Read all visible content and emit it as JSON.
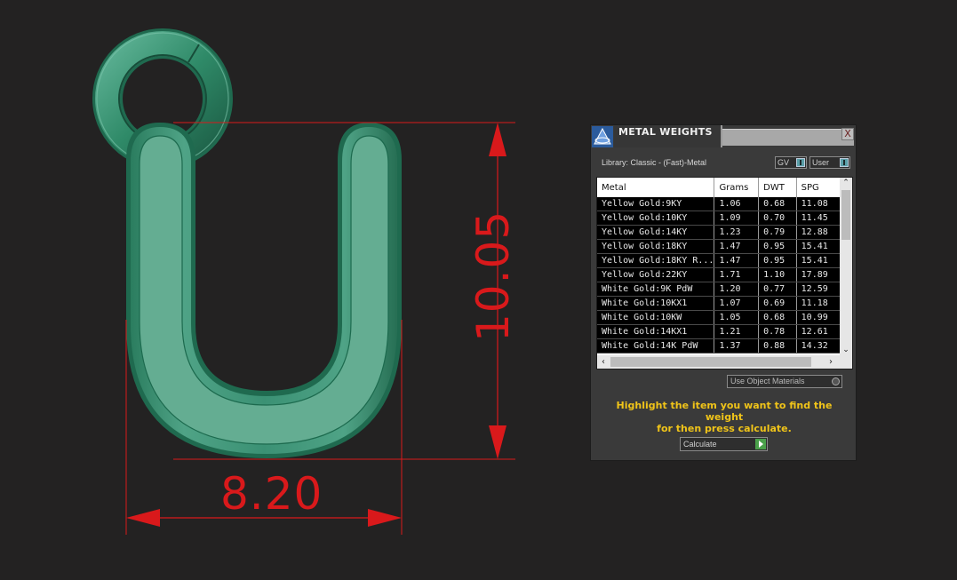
{
  "viewport": {
    "dimension_vertical": "10.05",
    "dimension_horizontal": "8.20",
    "colors": {
      "background": "#232222",
      "model": "#2f8a68",
      "dimension": "#d9191b"
    }
  },
  "panel": {
    "title": "METAL WEIGHTS",
    "close_label": "X",
    "library_label": "Library: Classic - (Fast)-Metal",
    "gv_toggle": "GV",
    "user_toggle": "User",
    "table": {
      "columns": [
        "Metal",
        "Grams",
        "DWT",
        "SPG"
      ],
      "rows": [
        [
          "Yellow Gold:9KY",
          "1.06",
          "0.68",
          "11.08"
        ],
        [
          "Yellow Gold:10KY",
          "1.09",
          "0.70",
          "11.45"
        ],
        [
          "Yellow Gold:14KY",
          "1.23",
          "0.79",
          "12.88"
        ],
        [
          "Yellow Gold:18KY",
          "1.47",
          "0.95",
          "15.41"
        ],
        [
          "Yellow Gold:18KY R...",
          "1.47",
          "0.95",
          "15.41"
        ],
        [
          "Yellow Gold:22KY",
          "1.71",
          "1.10",
          "17.89"
        ],
        [
          "White Gold:9K PdW",
          "1.20",
          "0.77",
          "12.59"
        ],
        [
          "White Gold:10KX1",
          "1.07",
          "0.69",
          "11.18"
        ],
        [
          "White Gold:10KW",
          "1.05",
          "0.68",
          "10.99"
        ],
        [
          "White Gold:14KX1",
          "1.21",
          "0.78",
          "12.61"
        ],
        [
          "White Gold:14K PdW",
          "1.37",
          "0.88",
          "14.32"
        ]
      ]
    },
    "use_object_materials": "Use Object Materials",
    "hint_line1": "Highlight the item you want to find the weight",
    "hint_line2": "for then press calculate.",
    "calculate_label": "Calculate",
    "accent_hint_color": "#f0c419"
  }
}
